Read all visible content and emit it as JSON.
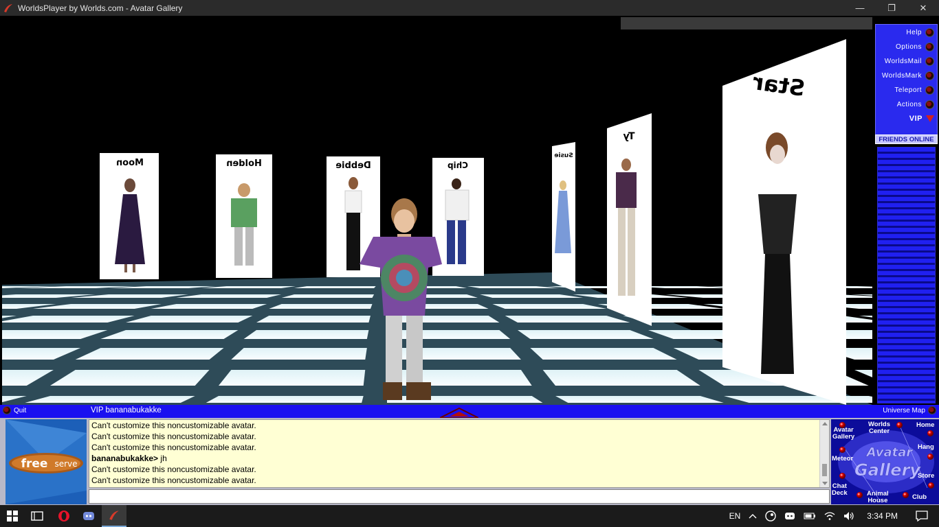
{
  "window": {
    "title": "WorldsPlayer by Worlds.com - Avatar Gallery",
    "minimize_glyph": "—",
    "restore_glyph": "❐",
    "close_glyph": "✕"
  },
  "scene": {
    "panels": [
      {
        "name": "Moon"
      },
      {
        "name": "Holden"
      },
      {
        "name": "Debbie"
      },
      {
        "name": "Chip"
      },
      {
        "name": "Susie"
      },
      {
        "name": "Ty"
      },
      {
        "name": "Star"
      }
    ]
  },
  "nav": {
    "help": "Help",
    "options": "Options",
    "worldsmail": "WorldsMail",
    "worldsmark": "WorldsMark",
    "teleport": "Teleport",
    "actions": "Actions",
    "vip": "VIP",
    "friends_online": "FRIENDS ONLINE"
  },
  "status": {
    "quit": "Quit",
    "vip_user": "VIP bananabukakke",
    "universe_map": "Universe Map"
  },
  "ad": {
    "free": "free",
    "serve": "serve"
  },
  "chat": {
    "lines": [
      {
        "text": "Can't customize this noncustomizable avatar."
      },
      {
        "text": "Can't customize this noncustomizable avatar."
      },
      {
        "text": "Can't customize this noncustomizable avatar."
      },
      {
        "speaker": "bananabukakke>",
        "text": " jh"
      },
      {
        "text": "Can't customize this noncustomizable avatar."
      },
      {
        "text": "Can't customize this noncustomizable avatar."
      }
    ],
    "input_value": ""
  },
  "worldmap": {
    "avatar_gallery_1": "Avatar",
    "avatar_gallery_2": "Gallery",
    "worlds_center_1": "Worlds",
    "worlds_center_2": "Center",
    "home": "Home",
    "meteor": "Meteor",
    "hang": "Hang",
    "store": "Store",
    "chat_deck_1": "Chat",
    "chat_deck_2": "Deck",
    "animal_house_1": "Animal",
    "animal_house_2": "House",
    "club": "Club",
    "logo_1": "Avatar",
    "logo_2": "Gallery"
  },
  "taskbar": {
    "language": "EN",
    "time": "3:34 PM"
  }
}
